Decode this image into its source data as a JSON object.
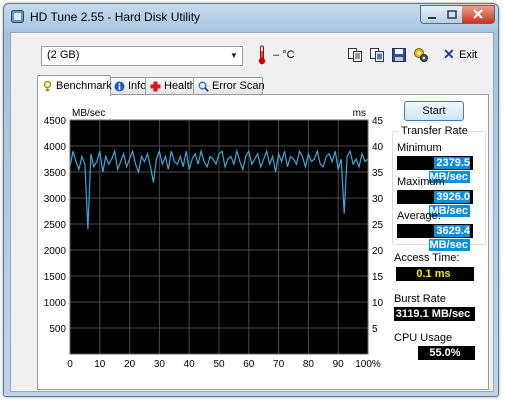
{
  "window": {
    "title": "HD Tune 2.55 - Hard Disk Utility"
  },
  "toolbar": {
    "drive": "(2 GB)",
    "temperature": "– °C",
    "exit_label": "Exit"
  },
  "tabs": [
    {
      "label": "Benchmark",
      "icon": "benchmark-icon",
      "active": true
    },
    {
      "label": "Info",
      "icon": "info-icon",
      "active": false
    },
    {
      "label": "Health",
      "icon": "health-icon",
      "active": false
    },
    {
      "label": "Error Scan",
      "icon": "error-scan-icon",
      "active": false
    }
  ],
  "benchmark": {
    "start_label": "Start",
    "transfer_rate_title": "Transfer Rate",
    "minimum_label": "Minimum",
    "minimum_value": "2379.5 MB/sec",
    "maximum_label": "Maximum",
    "maximum_value": "3926.0 MB/sec",
    "average_label": "Average:",
    "average_value": "3629.4 MB/sec",
    "access_label": "Access Time:",
    "access_value": "0.1 ms",
    "burst_label": "Burst Rate",
    "burst_value": "3119.1 MB/sec",
    "cpu_label": "CPU Usage",
    "cpu_value": "55.0%"
  },
  "chart_data": {
    "type": "line",
    "ylabel_left": "MB/sec",
    "ylabel_right": "ms",
    "xlim": [
      0,
      100
    ],
    "ylim_left": [
      0,
      4500
    ],
    "ylim_right": [
      0,
      45
    ],
    "x_ticks": [
      "0",
      "10",
      "20",
      "30",
      "40",
      "50",
      "60",
      "70",
      "80",
      "90",
      "100%"
    ],
    "y_ticks_left": [
      "500",
      "1000",
      "1500",
      "2000",
      "2500",
      "3000",
      "3500",
      "4000",
      "4500"
    ],
    "y_ticks_right": [
      "5",
      "10",
      "15",
      "20",
      "25",
      "30",
      "35",
      "40",
      "45"
    ],
    "grid": true,
    "colors": {
      "background": "#000000",
      "grid": "#4a4a4a",
      "series": "#3aa9d8"
    },
    "series": [
      {
        "x": [
          0,
          1,
          2,
          3,
          4,
          5,
          6,
          7,
          8,
          9,
          10,
          11,
          12,
          13,
          14,
          15,
          16,
          17,
          18,
          19,
          20,
          21,
          22,
          23,
          24,
          25,
          26,
          27,
          28,
          29,
          30,
          31,
          32,
          33,
          34,
          35,
          36,
          37,
          38,
          39,
          40,
          41,
          42,
          43,
          44,
          45,
          46,
          47,
          48,
          49,
          50,
          51,
          52,
          53,
          54,
          55,
          56,
          57,
          58,
          59,
          60,
          61,
          62,
          63,
          64,
          65,
          66,
          67,
          68,
          69,
          70,
          71,
          72,
          73,
          74,
          75,
          76,
          77,
          78,
          79,
          80,
          81,
          82,
          83,
          84,
          85,
          86,
          87,
          88,
          89,
          90,
          91,
          92,
          93,
          94,
          95,
          96,
          97,
          98,
          99,
          100
        ],
        "values": [
          3600,
          3900,
          3700,
          3550,
          3800,
          3650,
          2400,
          3850,
          3600,
          3700,
          3900,
          3500,
          3800,
          3650,
          3750,
          3900,
          3550,
          3700,
          3850,
          3600,
          3750,
          3900,
          3650,
          3500,
          3800,
          3700,
          3850,
          3600,
          3300,
          3750,
          3900,
          3650,
          3800,
          3550,
          3900,
          3700,
          3650,
          3800,
          3600,
          3900,
          3550,
          3750,
          3850,
          3650,
          3900,
          3700,
          3600,
          3800,
          3750,
          3650,
          3850,
          3900,
          3600,
          3750,
          3800,
          3650,
          3900,
          3700,
          3550,
          3800,
          3900,
          3650,
          3750,
          3850,
          3600,
          3750,
          3900,
          3650,
          3800,
          3500,
          3850,
          3700,
          3900,
          3600,
          3800,
          3750,
          3650,
          3900,
          3800,
          3600,
          3850,
          3700,
          3750,
          3900,
          3650,
          3600,
          3800,
          3850,
          3700,
          3900,
          3550,
          3750,
          2700,
          3800,
          3900,
          3650,
          3750,
          3600,
          3850,
          3700,
          3750
        ]
      }
    ]
  }
}
